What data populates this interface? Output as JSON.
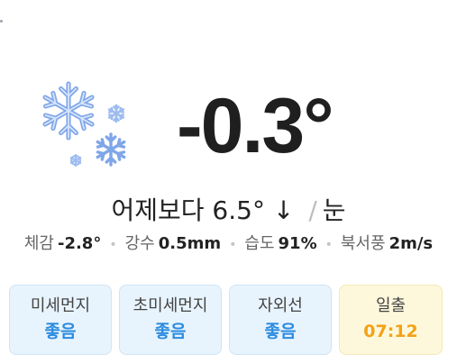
{
  "current": {
    "condition_icon": "snowflakes-icon",
    "temperature": "-0.3°",
    "compare_yesterday": "어제보다 6.5° ↓",
    "separator": "/",
    "condition": "눈"
  },
  "details": [
    {
      "label": "체감",
      "value": "-2.8°"
    },
    {
      "label": "강수",
      "value": "0.5mm"
    },
    {
      "label": "습도",
      "value": "91%"
    },
    {
      "label": "북서풍",
      "value": "2m/s"
    }
  ],
  "cards": [
    {
      "label": "미세먼지",
      "value": "좋음"
    },
    {
      "label": "초미세먼지",
      "value": "좋음"
    },
    {
      "label": "자외선",
      "value": "좋음"
    },
    {
      "label": "일출",
      "value": "07:12"
    }
  ],
  "colors": {
    "status_good": "#2b8be0",
    "sunrise": "#f3a216",
    "card_blue_bg": "#e8f4fd",
    "card_yellow_bg": "#fdf8dc"
  }
}
